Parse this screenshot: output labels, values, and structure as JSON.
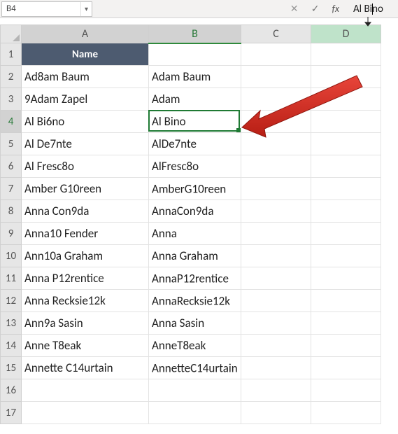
{
  "namebox": {
    "value": "B4"
  },
  "formula_bar": {
    "cancel_glyph": "✕",
    "enter_glyph": "✓",
    "fx_label": "fx",
    "value_before": "Al Bi",
    "value_after": "no"
  },
  "columns": {
    "A": "A",
    "B": "B",
    "C": "C",
    "D": "D"
  },
  "rows": {
    "header": {
      "A": "Name",
      "B": ""
    },
    "data": [
      {
        "n": "2",
        "A": "Ad8am Baum",
        "B": "Adam Baum"
      },
      {
        "n": "3",
        "A": "9Adam Zapel",
        "B": "Adam"
      },
      {
        "n": "4",
        "A": "Al Bi6no",
        "B": "Al Bino"
      },
      {
        "n": "5",
        "A": "Al De7nte",
        "B": "AlDe7nte"
      },
      {
        "n": "6",
        "A": "Al Fresc8o",
        "B": "AlFresc8o"
      },
      {
        "n": "7",
        "A": "Amber G10reen",
        "B": "AmberG10reen"
      },
      {
        "n": "8",
        "A": "Anna Con9da",
        "B": "AnnaCon9da"
      },
      {
        "n": "9",
        "A": "Anna10 Fender",
        "B": "Anna"
      },
      {
        "n": "10",
        "A": "Ann10a Graham",
        "B": "Anna Graham"
      },
      {
        "n": "11",
        "A": "Anna P12rentice",
        "B": "AnnaP12rentice"
      },
      {
        "n": "12",
        "A": "Anna Recksie12k",
        "B": "AnnaRecksie12k"
      },
      {
        "n": "13",
        "A": "Ann9a Sasin",
        "B": "Anna Sasin"
      },
      {
        "n": "14",
        "A": "Anne T8eak",
        "B": "AnneT8eak"
      },
      {
        "n": "15",
        "A": "Annette C14urtain",
        "B": "AnnetteC14urtain"
      }
    ],
    "empty": [
      "16",
      "17"
    ]
  },
  "active_cell": "B4",
  "colors": {
    "selection_green": "#1f7a34",
    "arrow_red": "#d82a1f"
  }
}
